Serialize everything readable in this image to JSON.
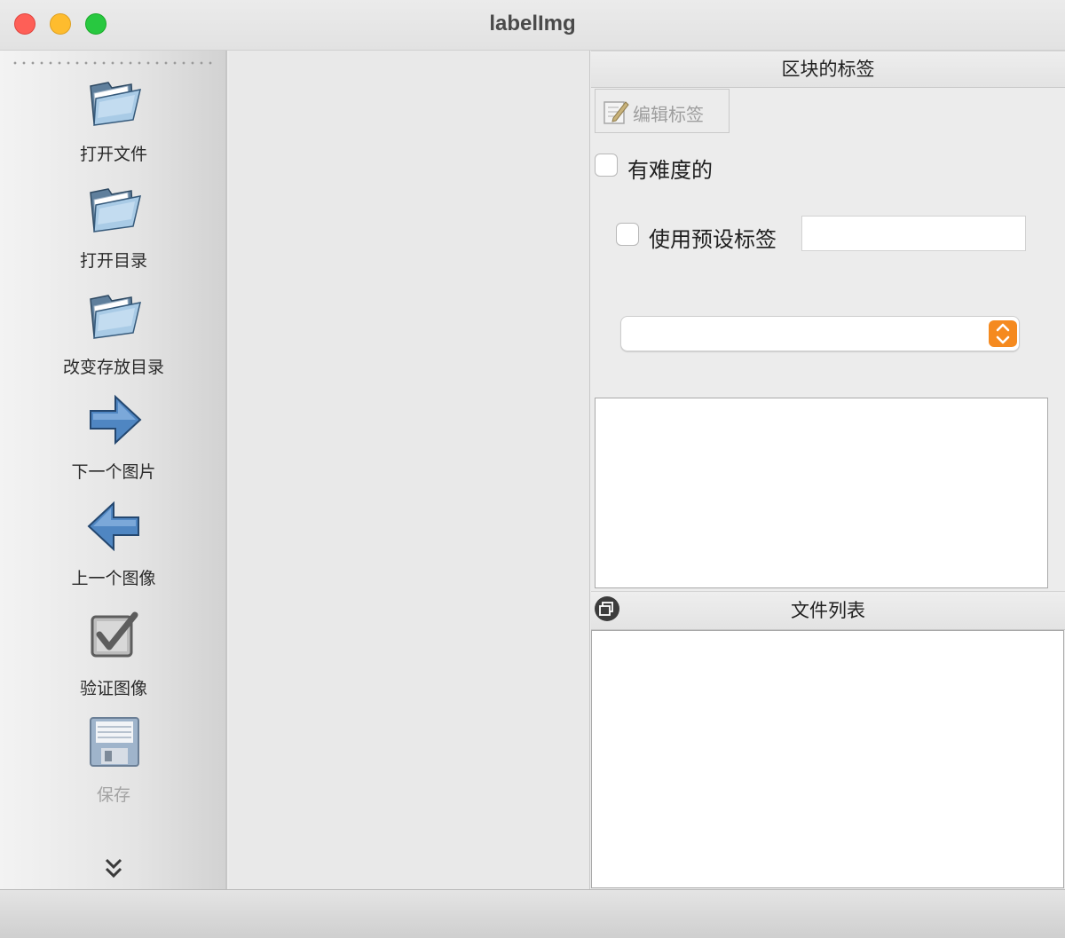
{
  "window": {
    "title": "labelImg"
  },
  "toolbar": {
    "items": [
      {
        "label": "打开文件",
        "icon": "folder-open-icon"
      },
      {
        "label": "打开目录",
        "icon": "folder-open-icon"
      },
      {
        "label": "改变存放目录",
        "icon": "folder-open-icon"
      },
      {
        "label": "下一个图片",
        "icon": "arrow-right-icon"
      },
      {
        "label": "上一个图像",
        "icon": "arrow-left-icon"
      },
      {
        "label": "验证图像",
        "icon": "checkbox-icon"
      },
      {
        "label": "保存",
        "icon": "floppy-disk-icon",
        "disabled": true
      }
    ],
    "more_icon": "double-chevron-down-icon"
  },
  "label_dock": {
    "title": "区块的标签",
    "edit_label_button": "编辑标签",
    "difficult_checkbox": {
      "label": "有难度的",
      "checked": false
    },
    "default_label_checkbox": {
      "label": "使用预设标签",
      "checked": false
    },
    "default_label_value": "",
    "combo_value": ""
  },
  "file_dock": {
    "title": "文件列表"
  },
  "colors": {
    "accent": "#f58a1f",
    "close": "#fe5f57",
    "minimize": "#febc2e",
    "maximize": "#28c840"
  }
}
